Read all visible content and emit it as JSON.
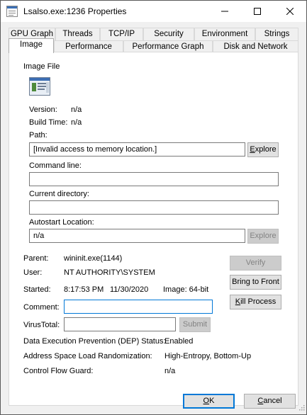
{
  "window": {
    "title": "Lsalso.exe:1236 Properties"
  },
  "tabs_row1": [
    "GPU Graph",
    "Threads",
    "TCP/IP",
    "Security",
    "Environment",
    "Strings"
  ],
  "tabs_row2": [
    "Image",
    "Performance",
    "Performance Graph",
    "Disk and Network"
  ],
  "active_tab": "Image",
  "image_file": {
    "group_label": "Image File",
    "version_label": "Version:",
    "version_value": "n/a",
    "build_time_label": "Build Time:",
    "build_time_value": "n/a",
    "path_label": "Path:",
    "path_value": "[Invalid access to memory location.]",
    "explore_label": "Explore",
    "command_line_label": "Command line:",
    "command_line_value": "",
    "current_directory_label": "Current directory:",
    "current_directory_value": "",
    "autostart_label": "Autostart Location:",
    "autostart_value": "n/a",
    "autostart_explore_label": "Explore"
  },
  "process": {
    "parent_label": "Parent:",
    "parent_value": "wininit.exe(1144)",
    "user_label": "User:",
    "user_value": "NT AUTHORITY\\SYSTEM",
    "started_label": "Started:",
    "started_time": "8:17:53 PM",
    "started_date": "11/30/2020",
    "image_bits": "Image: 64-bit",
    "comment_label": "Comment:",
    "comment_value": "",
    "virustotal_label": "VirusTotal:",
    "virustotal_value": "",
    "submit_label": "Submit",
    "verify_label": "Verify",
    "bring_to_front_label": "Bring to Front",
    "kill_process_label": "Kill Process",
    "dep_label": "Data Execution Prevention (DEP) Status:",
    "dep_value": "Enabled",
    "aslr_label": "Address Space Load Randomization:",
    "aslr_value": "High-Entropy, Bottom-Up",
    "cfg_label": "Control Flow Guard:",
    "cfg_value": "n/a"
  },
  "footer": {
    "ok_label": "OK",
    "cancel_label": "Cancel"
  },
  "colors": {
    "accent": "#0078d7",
    "window_bg": "#f0f0f0",
    "panel_bg": "#ffffff",
    "disabled_text": "#838383"
  }
}
